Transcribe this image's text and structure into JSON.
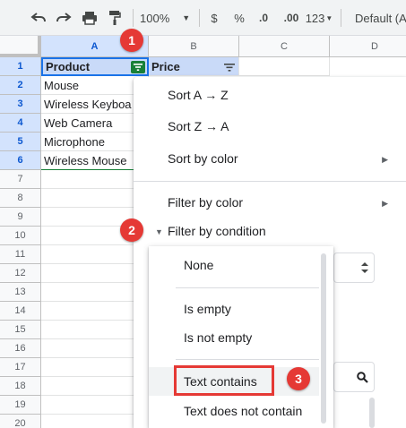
{
  "toolbar": {
    "zoom": "100%",
    "currency": "$",
    "percent": "%",
    "decrease_decimal": ".0",
    "increase_decimal": ".00",
    "more_formats": "123",
    "font": "Default (Ar"
  },
  "columns": [
    "A",
    "B",
    "C",
    "D"
  ],
  "rows": [
    "1",
    "2",
    "3",
    "4",
    "5",
    "6",
    "7",
    "8",
    "9",
    "10",
    "11",
    "12",
    "13",
    "14",
    "15",
    "16",
    "17",
    "18",
    "19",
    "20"
  ],
  "sheet": {
    "header": {
      "product": "Product",
      "price": "Price"
    },
    "products": [
      "Mouse",
      "Wireless Keyboa",
      "Web Camera",
      "Microphone",
      "Wireless Mouse"
    ]
  },
  "filter_menu": {
    "sort_az": "Sort A → Z",
    "sort_za": "Sort Z → A",
    "sort_by_color": "Sort by color",
    "filter_by_color": "Filter by color",
    "filter_by_condition": "Filter by condition"
  },
  "condition_options": [
    "None",
    "Is empty",
    "Is not empty",
    "Text contains",
    "Text does not contain"
  ],
  "annotations": [
    "1",
    "2",
    "3"
  ],
  "colors": {
    "header_fill": "#c9daf8",
    "filter_active": "#188038",
    "badge": "#e53935",
    "selected_header": "#d3e3fd"
  }
}
